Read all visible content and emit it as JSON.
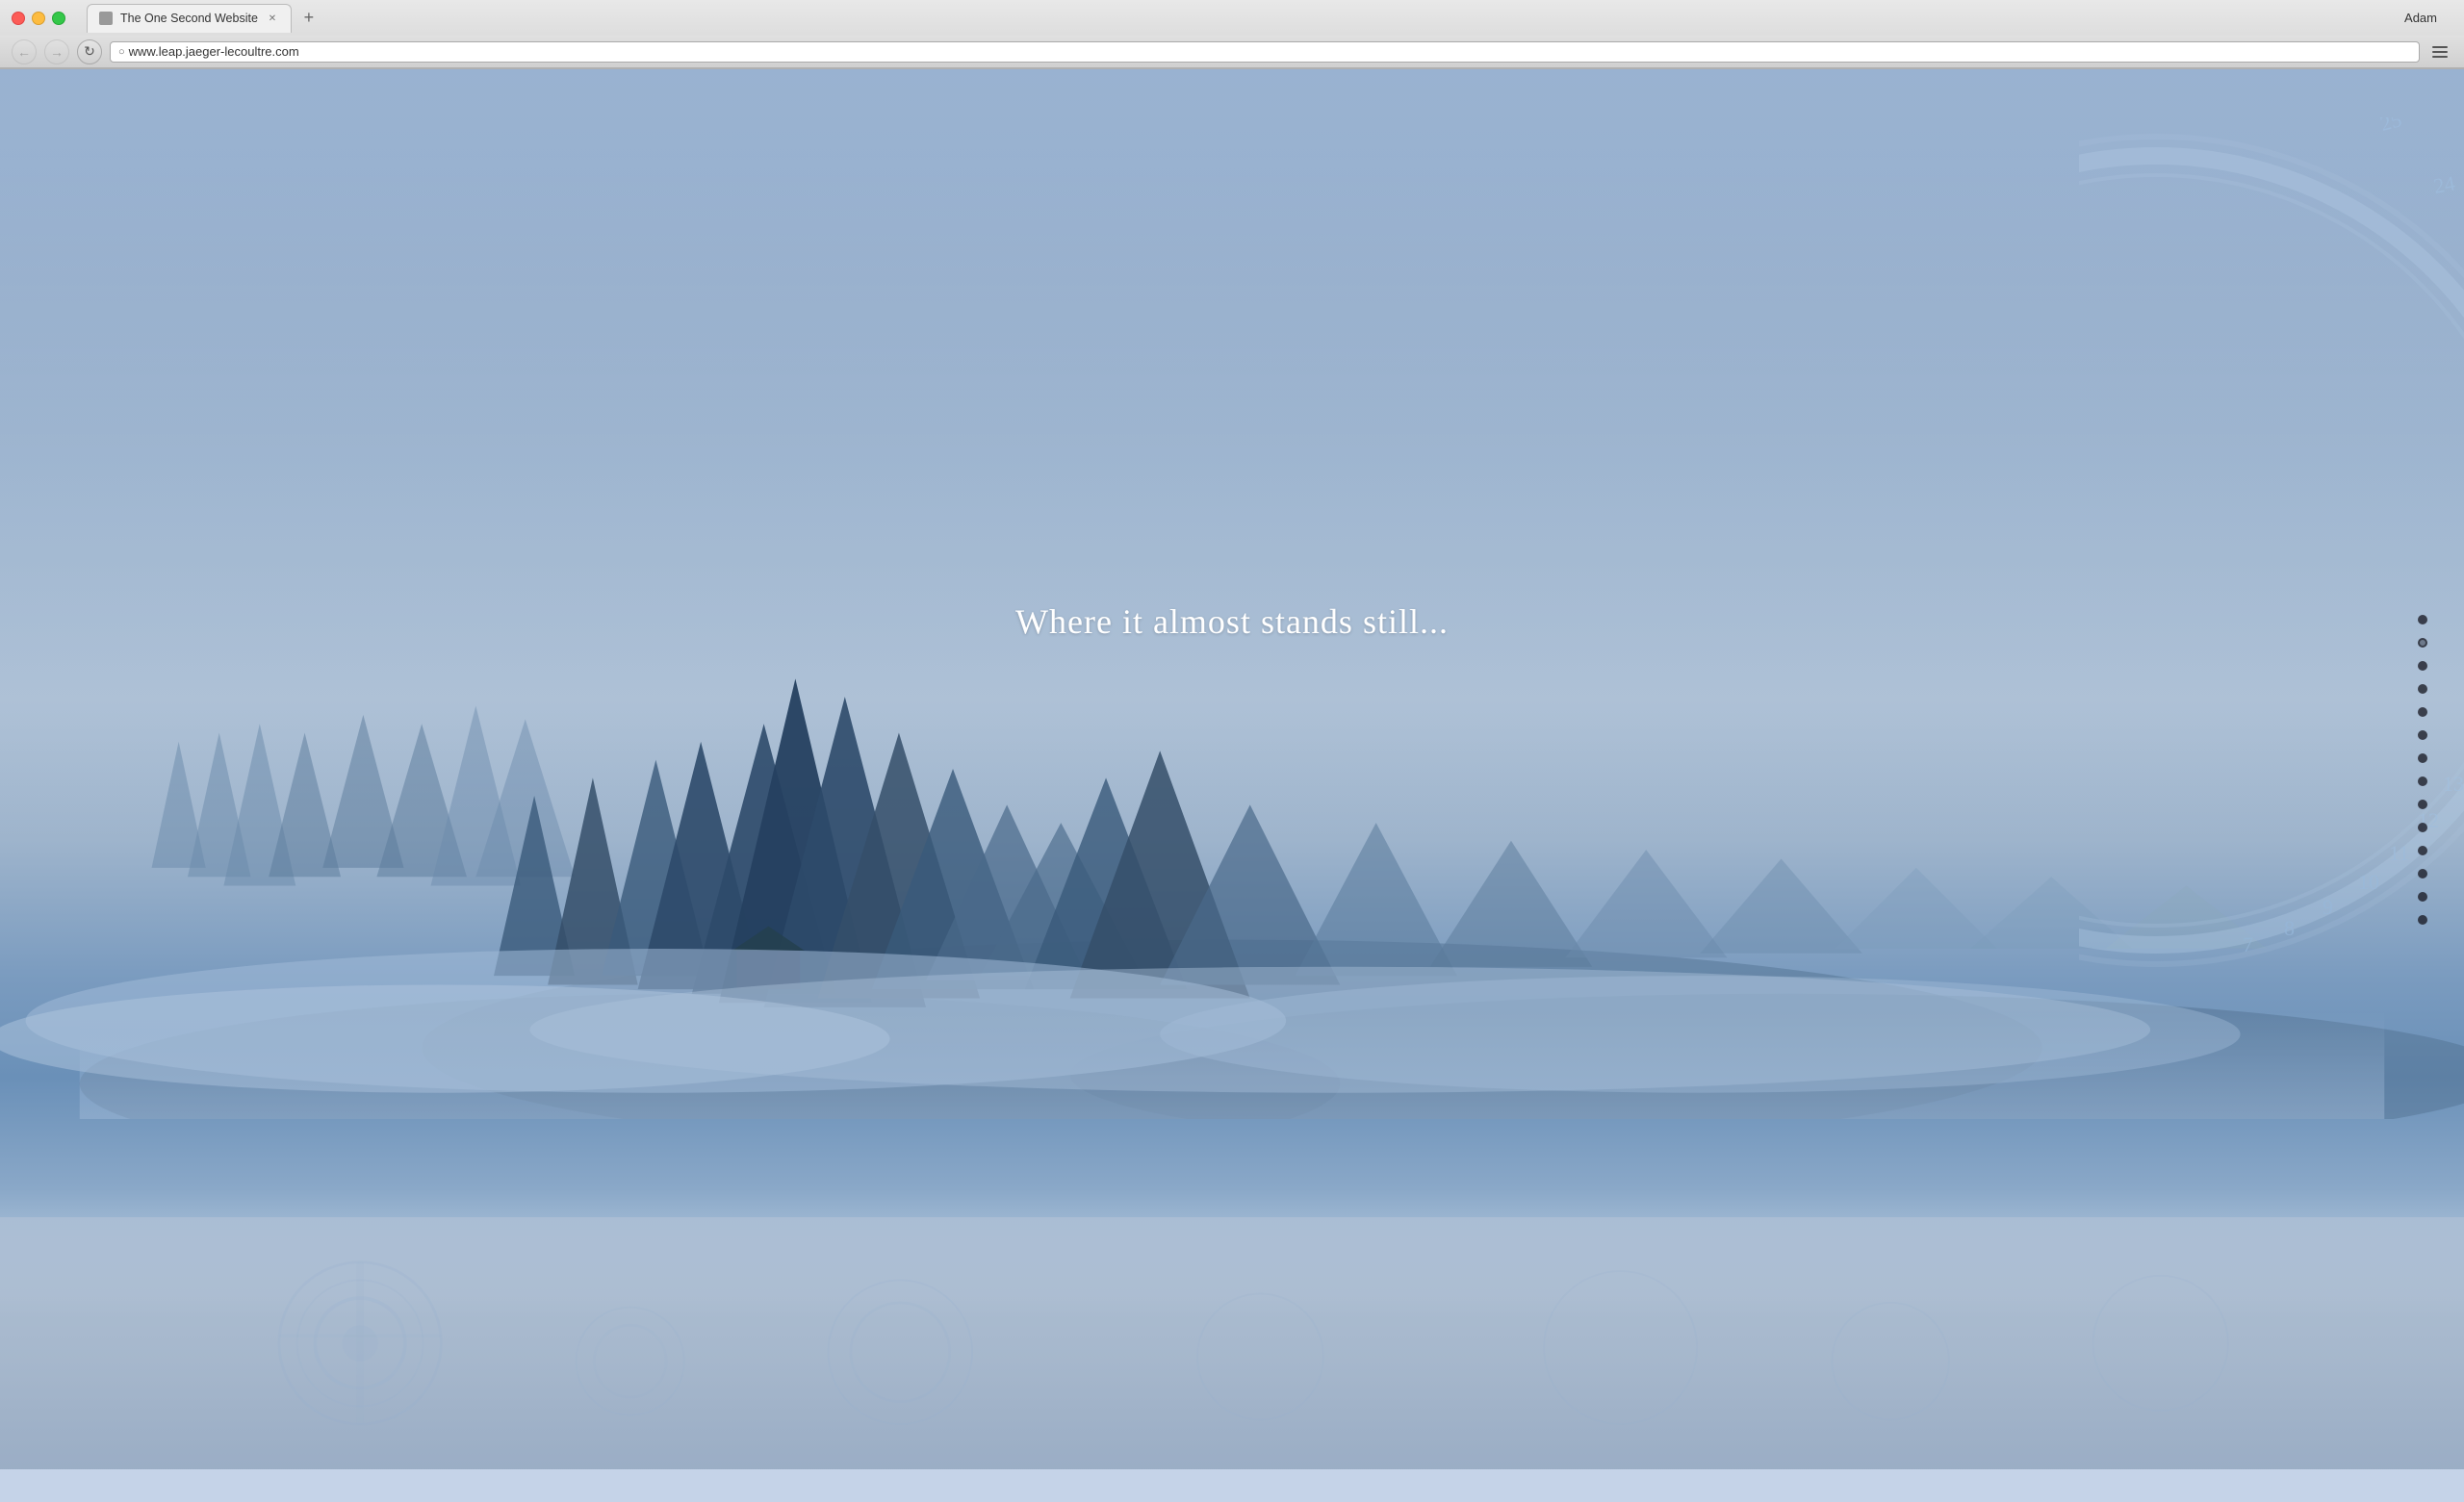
{
  "browser": {
    "tab_title": "The One Second Website",
    "url": "www.leap.jaeger-lecoultre.com",
    "user_label": "Adam",
    "nav": {
      "back_disabled": true,
      "forward_disabled": true
    }
  },
  "page": {
    "hero_text": "Where it almost stands still...",
    "nav_dots_count": 14,
    "active_dot_index": 1
  }
}
